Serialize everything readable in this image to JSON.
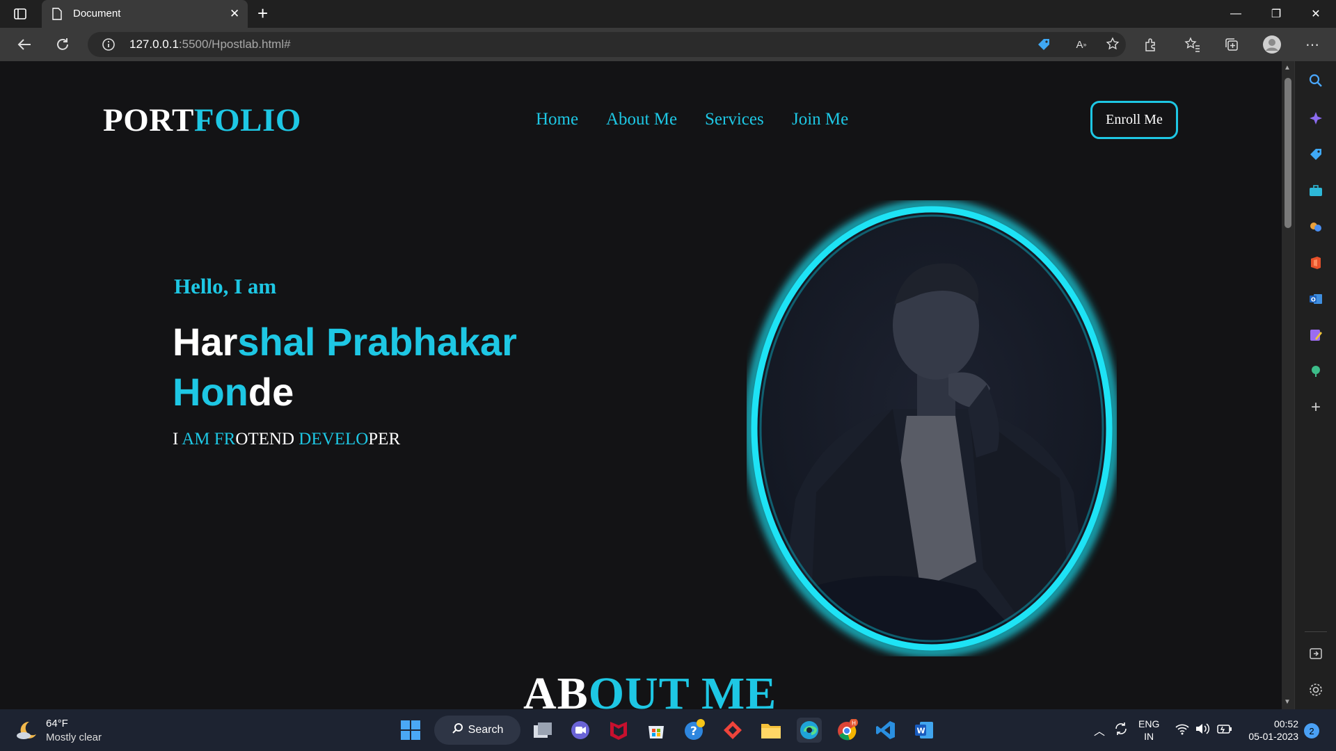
{
  "browser": {
    "tab_title": "Document",
    "url_host": "127.0.0.1",
    "url_path": ":5500/Hpostlab.html#"
  },
  "site": {
    "logo_part1": "PORT",
    "logo_part2": "FOLIO",
    "nav": [
      "Home",
      "About Me",
      "Services",
      "Join Me"
    ],
    "enroll_label": "Enroll Me",
    "hello": "Hello, I am",
    "name_white1": "Har",
    "name_cyan1": "shal Prabhakar",
    "name_cyan2": "Hon",
    "name_white2": "de",
    "role_1": "I ",
    "role_2": "AM FR",
    "role_3": "OTEND ",
    "role_4": "DEVELO",
    "role_5": "PER",
    "about_part1": "AB",
    "about_part2": "OUT ME",
    "accent_color": "#1ec7e4"
  },
  "taskbar": {
    "temperature": "64°F",
    "weather": "Mostly clear",
    "search_label": "Search",
    "lang_1": "ENG",
    "lang_2": "IN",
    "time": "00:52",
    "date": "05-01-2023",
    "notification_count": "2"
  }
}
